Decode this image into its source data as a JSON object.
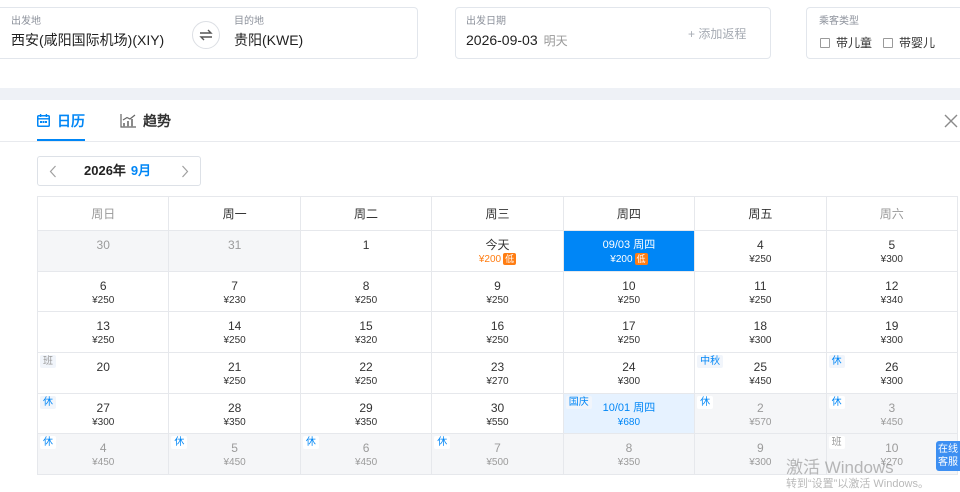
{
  "search": {
    "from_label": "出发地",
    "from_value": "西安(咸阳国际机场)(XIY)",
    "swap_icon": "swap-arrows-icon",
    "to_label": "目的地",
    "to_value": "贵阳(KWE)",
    "date_label": "出发日期",
    "date_value": "2026-09-03",
    "date_note": "明天",
    "add_return": "+ 添加返程",
    "passenger_label": "乘客类型",
    "passenger_options": [
      {
        "label": "带儿童",
        "checked": false
      },
      {
        "label": "带婴儿",
        "checked": false
      }
    ]
  },
  "panel": {
    "tabs": [
      {
        "label": "日历",
        "icon": "calendar-icon",
        "active": true
      },
      {
        "label": "趋势",
        "icon": "trend-chart-icon",
        "active": false
      }
    ],
    "close_icon": "close-icon",
    "month_picker": {
      "prev_icon": "chevron-left-icon",
      "year": "2026年",
      "month": "9月",
      "next_icon": "chevron-right-icon"
    }
  },
  "calendar": {
    "weekdays": [
      "周日",
      "周一",
      "周二",
      "周三",
      "周四",
      "周五",
      "周六"
    ],
    "weeks": [
      [
        {
          "day": "30",
          "outside": true
        },
        {
          "day": "31",
          "outside": true
        },
        {
          "day": "1"
        },
        {
          "day": "今天",
          "price": "¥200",
          "badge": "低",
          "today": true
        },
        {
          "day": "09/03 周四",
          "price": "¥200",
          "badge": "低",
          "selected": true
        },
        {
          "day": "4",
          "price": "¥250"
        },
        {
          "day": "5",
          "price": "¥300"
        }
      ],
      [
        {
          "day": "6",
          "price": "¥250"
        },
        {
          "day": "7",
          "price": "¥230"
        },
        {
          "day": "8",
          "price": "¥250"
        },
        {
          "day": "9",
          "price": "¥250"
        },
        {
          "day": "10",
          "price": "¥250"
        },
        {
          "day": "11",
          "price": "¥250"
        },
        {
          "day": "12",
          "price": "¥340"
        }
      ],
      [
        {
          "day": "13",
          "price": "¥250"
        },
        {
          "day": "14",
          "price": "¥250"
        },
        {
          "day": "15",
          "price": "¥320"
        },
        {
          "day": "16",
          "price": "¥250"
        },
        {
          "day": "17",
          "price": "¥250"
        },
        {
          "day": "18",
          "price": "¥300"
        },
        {
          "day": "19",
          "price": "¥300"
        }
      ],
      [
        {
          "day": "20",
          "tag": "班",
          "workday": true
        },
        {
          "day": "21",
          "price": "¥250"
        },
        {
          "day": "22",
          "price": "¥250"
        },
        {
          "day": "23",
          "price": "¥270"
        },
        {
          "day": "24",
          "price": "¥300"
        },
        {
          "day": "25",
          "price": "¥450",
          "tag": "中秋"
        },
        {
          "day": "26",
          "price": "¥300",
          "tag": "休"
        }
      ],
      [
        {
          "day": "27",
          "price": "¥300",
          "tag": "休"
        },
        {
          "day": "28",
          "price": "¥350"
        },
        {
          "day": "29",
          "price": "¥350"
        },
        {
          "day": "30",
          "price": "¥550"
        },
        {
          "day": "10/01 周四",
          "price": "¥680",
          "tag": "国庆",
          "highlight": true
        },
        {
          "day": "2",
          "price": "¥570",
          "tag": "休",
          "outside": true
        },
        {
          "day": "3",
          "price": "¥450",
          "tag": "休",
          "outside": true
        }
      ],
      [
        {
          "day": "4",
          "price": "¥450",
          "tag": "休",
          "outside": true
        },
        {
          "day": "5",
          "price": "¥450",
          "tag": "休",
          "outside": true
        },
        {
          "day": "6",
          "price": "¥450",
          "tag": "休",
          "outside": true
        },
        {
          "day": "7",
          "price": "¥500",
          "tag": "休",
          "outside": true
        },
        {
          "day": "8",
          "price": "¥350",
          "outside": true
        },
        {
          "day": "9",
          "price": "¥300",
          "outside": true
        },
        {
          "day": "10",
          "price": "¥270",
          "tag": "班",
          "workday": true,
          "outside": true
        }
      ]
    ]
  },
  "colors": {
    "accent": "#0086f6",
    "low_price": "#ff7d13",
    "highlight_bg": "#e6f2ff",
    "outside_bg": "#f5f6f8",
    "line": "#e6e8ec"
  },
  "overlays": {
    "support_badge": [
      "在线",
      "客服"
    ],
    "watermark": [
      "激活 Windows",
      "转到“设置”以激活 Windows。"
    ]
  }
}
